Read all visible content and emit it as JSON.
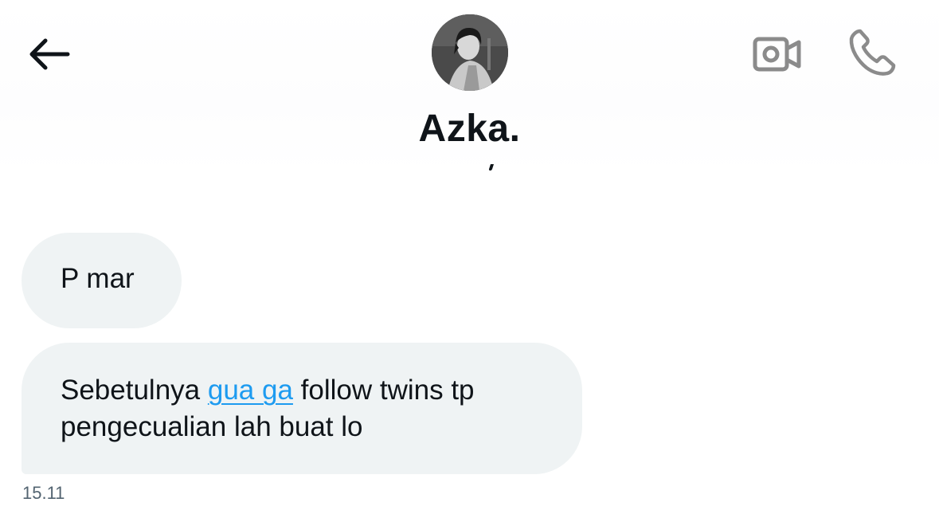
{
  "header": {
    "contact_name": "Azka.",
    "icons": {
      "back": "arrow-left-icon",
      "video": "video-camera-icon",
      "call": "phone-icon"
    }
  },
  "messages": [
    {
      "text": "P mar"
    },
    {
      "text_before": "Sebetulnya ",
      "link_text": "gua ga",
      "text_after": " follow twins tp pengecualian lah buat lo",
      "time": "15.11"
    }
  ],
  "colors": {
    "bubble": "#eff3f4",
    "link": "#1d9bf0",
    "timestamp": "#536471",
    "icon_gray": "#8b8b8b"
  }
}
